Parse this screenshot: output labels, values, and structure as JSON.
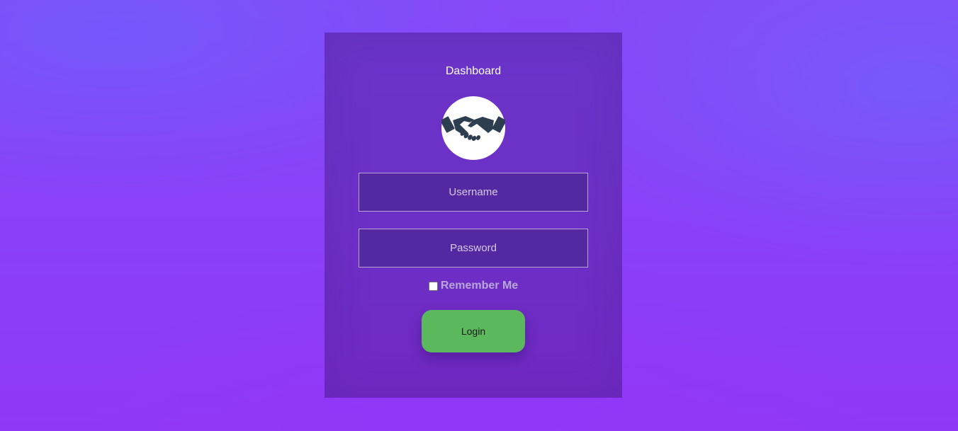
{
  "form": {
    "title": "Dashboard",
    "avatar_icon": "handshake-icon",
    "username": {
      "placeholder": "Username",
      "value": ""
    },
    "password": {
      "placeholder": "Password",
      "value": ""
    },
    "remember_label": "Remember Me",
    "remember_checked": false,
    "login_label": "Login"
  },
  "colors": {
    "background": "#8a40f7",
    "panel": "#6d30c6",
    "field_bg": "#5428a0",
    "button": "#5cb85c",
    "icon": "#2c3e50"
  }
}
